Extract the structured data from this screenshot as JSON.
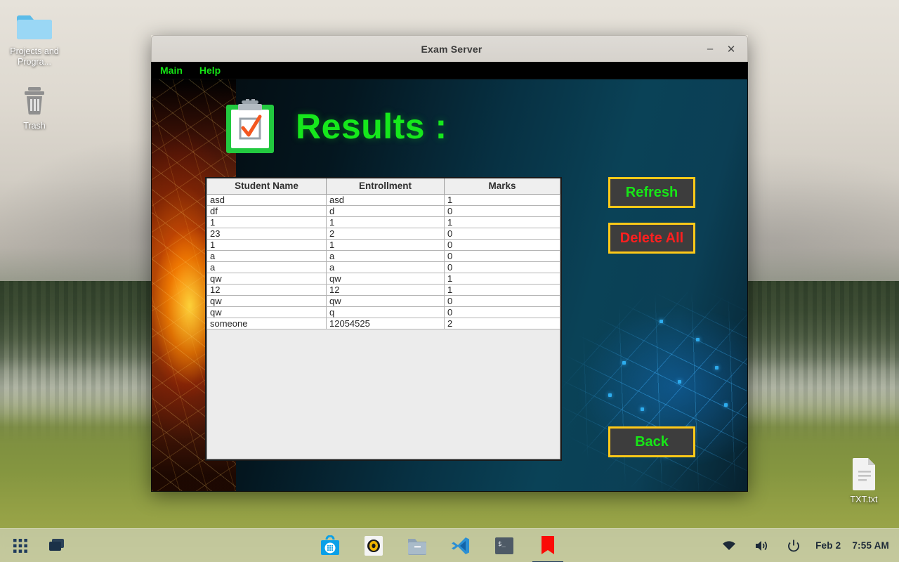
{
  "desktop": {
    "icons": [
      {
        "name": "Projects and Progra...",
        "icon": "folder-icon"
      },
      {
        "name": "Trash",
        "icon": "trash-icon"
      },
      {
        "name": "TXT.txt",
        "icon": "text-file-icon"
      }
    ]
  },
  "window": {
    "title": "Exam Server",
    "minimize_label": "–",
    "close_label": "✕",
    "menu": [
      {
        "label": "Main"
      },
      {
        "label": "Help"
      }
    ],
    "page_title": "Results :",
    "page_icon": "clipboard-check-icon",
    "accent_green": "#16e81c",
    "accent_gold": "#ffc918",
    "accent_red": "#ff1f1f",
    "button_fill": "#3d3d3d"
  },
  "table": {
    "columns": [
      "Student Name",
      "Entrollment",
      "Marks"
    ],
    "rows": [
      [
        "asd",
        "asd",
        "1"
      ],
      [
        "df",
        "d",
        "0"
      ],
      [
        "1",
        "1",
        "1"
      ],
      [
        "23",
        "2",
        "0"
      ],
      [
        "1",
        "1",
        "0"
      ],
      [
        "a",
        "a",
        "0"
      ],
      [
        "a",
        "a",
        "0"
      ],
      [
        "qw",
        "qw",
        "1"
      ],
      [
        "12",
        "12",
        "1"
      ],
      [
        "qw",
        "qw",
        "0"
      ],
      [
        "qw",
        "q",
        "0"
      ],
      [
        "someone",
        "12054525",
        "2"
      ]
    ]
  },
  "buttons": {
    "refresh": "Refresh",
    "delete_all": "Delete All",
    "back": "Back"
  },
  "taskbar": {
    "apps_grid": "apps-grid-icon",
    "workspaces": "workspaces-icon",
    "software_store": "software-store-icon",
    "media_player": "media-player-icon",
    "file_manager": "file-manager-icon",
    "vscode": "vscode-icon",
    "terminal": "terminal-icon",
    "bookmark_app": "bookmark-icon",
    "wifi": "wifi-icon",
    "volume": "volume-icon",
    "power": "power-icon",
    "date": "Feb 2",
    "time": "7:55 AM"
  }
}
